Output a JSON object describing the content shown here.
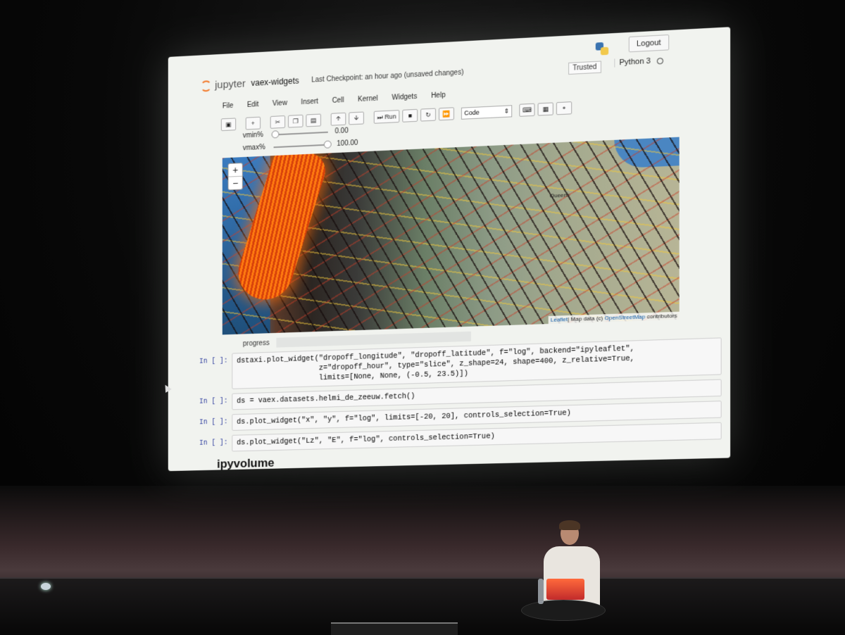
{
  "header": {
    "logo_text": "jupyter",
    "notebook_name": "vaex-widgets",
    "checkpoint": "Last Checkpoint: an hour ago",
    "unsaved": "(unsaved changes)",
    "logout_label": "Logout",
    "trusted_label": "Trusted",
    "kernel_name": "Python 3"
  },
  "menu": [
    "File",
    "Edit",
    "View",
    "Insert",
    "Cell",
    "Kernel",
    "Widgets",
    "Help"
  ],
  "toolbar": {
    "run_label": "Run",
    "cell_type": "Code",
    "icons": [
      "save-icon",
      "add-icon",
      "cut-icon",
      "copy-icon",
      "paste-icon",
      "move-up-icon",
      "move-down-icon",
      "run-icon",
      "stop-icon",
      "restart-icon",
      "fast-forward-icon",
      "keyboard-icon",
      "palette-icon",
      "share-icon"
    ]
  },
  "widgets": {
    "vmin_label": "vmin%",
    "vmin_value": "0.00",
    "vmin_fraction": 0.0,
    "vmax_label": "vmax%",
    "vmax_value": "100.00",
    "vmax_fraction": 1.0,
    "progress_label": "progress"
  },
  "map": {
    "zoom_in": "+",
    "zoom_out": "−",
    "place_label": "Queens",
    "attribution_leaflet": "Leaflet",
    "attribution_text": "| Map data (c) ",
    "attribution_osm": "OpenStreetMap",
    "attribution_tail": " contributors"
  },
  "cells": [
    {
      "prompt": "In [ ]:",
      "code": "dstaxi.plot_widget(\"dropoff_longitude\", \"dropoff_latitude\", f=\"log\", backend=\"ipyleaflet\",\n                   z=\"dropoff_hour\", type=\"slice\", z_shape=24, shape=400, z_relative=True,\n                   limits=[None, None, (-0.5, 23.5)])"
    },
    {
      "prompt": "In [ ]:",
      "code": "ds = vaex.datasets.helmi_de_zeeuw.fetch()"
    },
    {
      "prompt": "In [ ]:",
      "code": "ds.plot_widget(\"x\", \"y\", f=\"log\", limits=[-20, 20], controls_selection=True)"
    },
    {
      "prompt": "In [ ]:",
      "code": "ds.plot_widget(\"Lz\", \"E\", f=\"log\", controls_selection=True)"
    }
  ],
  "section_heading": "ipyvolume",
  "colors": {
    "jupyter_orange": "#f37726",
    "prompt_blue": "#303f9f",
    "heat_orange": "#ff7a10"
  }
}
